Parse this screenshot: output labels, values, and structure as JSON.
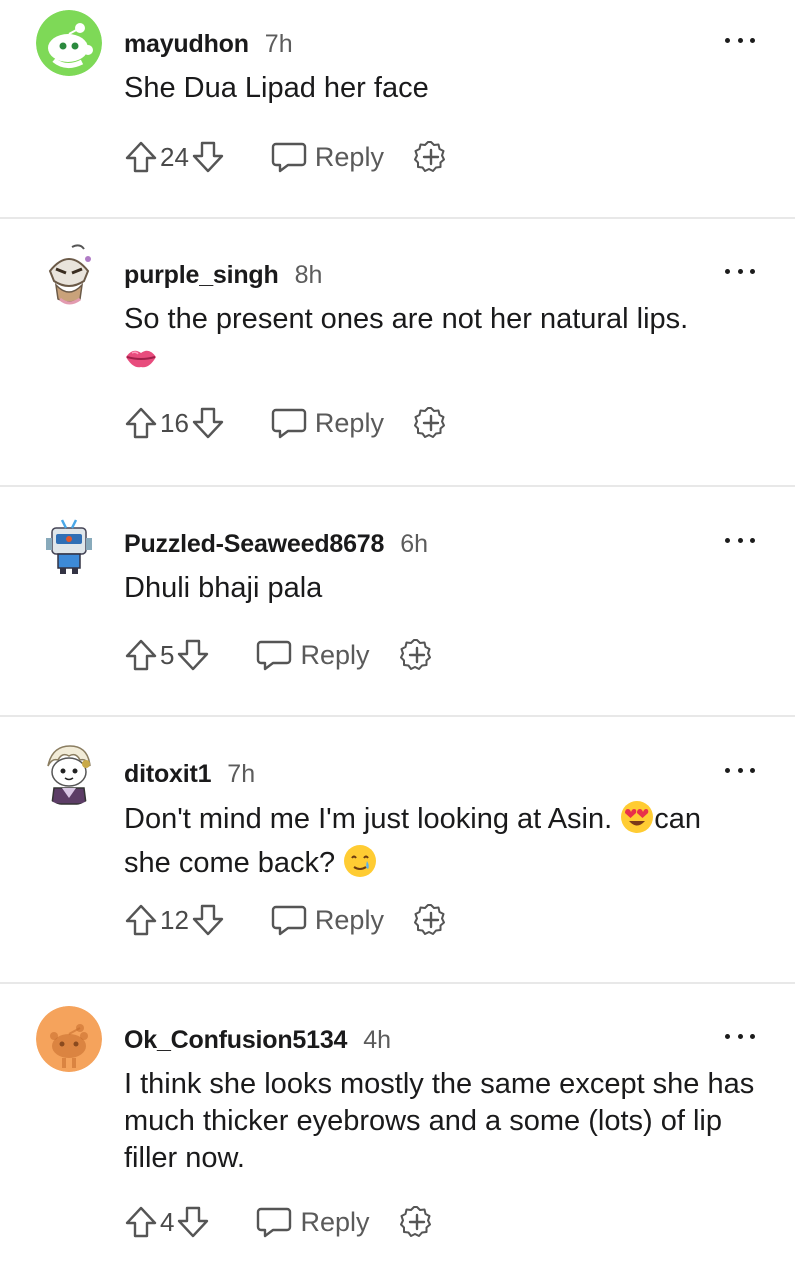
{
  "comments": [
    {
      "username": "mayudhon",
      "time": "7h",
      "text": "She Dua Lipad her face",
      "score": "24",
      "reply_label": "Reply"
    },
    {
      "username": "purple_singh",
      "time": "8h",
      "text": "So the present ones are not her natural lips.",
      "emoji": "lips-emoji",
      "score": "16",
      "reply_label": "Reply"
    },
    {
      "username": "Puzzled-Seaweed8678",
      "time": "6h",
      "text": "Dhuli bhaji pala",
      "score": "5",
      "reply_label": "Reply"
    },
    {
      "username": "ditoxit1",
      "time": "7h",
      "text_part1": "Don't mind me I'm just looking at Asin. ",
      "text_part2": "can she come back? ",
      "emoji1": "heart-eyes-emoji",
      "emoji2": "smiling-tear-emoji",
      "score": "12",
      "reply_label": "Reply"
    },
    {
      "username": "Ok_Confusion5134",
      "time": "4h",
      "text": "I think she looks mostly the same except she has much thicker eyebrows and a some (lots) of lip filler now.",
      "score": "4",
      "reply_label": "Reply"
    }
  ],
  "icons": {
    "upvote": "arrow-up-icon",
    "downvote": "arrow-down-icon",
    "reply": "speech-bubble-icon",
    "award": "award-plus-icon",
    "more": "ellipsis-icon"
  },
  "colors": {
    "text": "#1a1a1b",
    "muted": "#5c5c5c",
    "divider": "#e8e8e8",
    "avatar_green": "#7ed957",
    "avatar_orange": "#f5a35c"
  }
}
